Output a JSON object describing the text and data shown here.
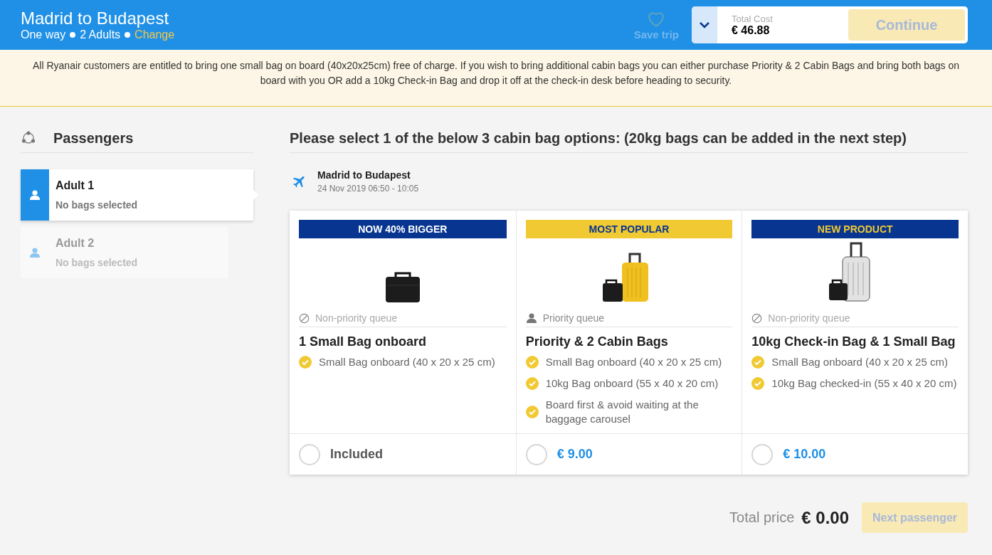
{
  "header": {
    "title": "Madrid to Budapest",
    "trip_type": "One way",
    "passengers": "2 Adults",
    "change_link": "Change",
    "save_trip": {
      "label": "Save trip",
      "disabled": true
    },
    "total_cost": {
      "label": "Total Cost",
      "amount": "€ 46.88"
    },
    "continue_button": {
      "label": "Continue",
      "disabled": true
    }
  },
  "notice": "All Ryanair customers are entitled to bring one small bag on board (40x20x25cm) free of charge. If you wish to bring additional cabin bags you can either purchase Priority & 2 Cabin Bags and bring both bags on board with you OR add a 10kg Check-in Bag and drop it off at the check-in desk before heading to security.",
  "sidebar": {
    "title": "Passengers",
    "passengers": [
      {
        "name": "Adult 1",
        "status": "No bags selected",
        "selected": true
      },
      {
        "name": "Adult 2",
        "status": "No bags selected",
        "selected": false
      }
    ]
  },
  "main": {
    "heading": "Please select 1 of the below 3 cabin bag options: (20kg bags can be added in the next step)",
    "flight": {
      "route": "Madrid to Budapest",
      "date_time": "24 Nov 2019  06:50 - 10:05"
    },
    "options": [
      {
        "badge": {
          "label": "NOW 40% BIGGER",
          "color": "#073590",
          "accent": false
        },
        "kind": "small-bag",
        "queue": {
          "priority": false,
          "label": "Non-priority queue"
        },
        "title": "1 Small Bag onboard",
        "features": [
          "Small Bag onboard (40 x 20 x 25 cm)"
        ],
        "price": "Included",
        "included": true,
        "selected": false
      },
      {
        "badge": {
          "label": "MOST POPULAR",
          "color": "#f1c933",
          "accent": false
        },
        "kind": "yellow-suitcase",
        "queue": {
          "priority": true,
          "label": "Priority queue"
        },
        "title": "Priority & 2 Cabin Bags",
        "features": [
          "Small Bag onboard (40 x 20 x 25 cm)",
          "10kg Bag onboard (55 x 40 x 20 cm)",
          "Board first & avoid waiting at the baggage carousel"
        ],
        "price": "€ 9.00",
        "included": false,
        "selected": false
      },
      {
        "badge": {
          "label": "NEW PRODUCT",
          "color": "#073590",
          "accent": true
        },
        "kind": "silver-suitcase",
        "queue": {
          "priority": false,
          "label": "Non-priority queue"
        },
        "title": "10kg Check-in Bag & 1 Small Bag",
        "features": [
          "Small Bag onboard (40 x 20 x 25 cm)",
          "10kg Bag checked-in (55 x 40 x 20 cm)"
        ],
        "price": "€ 10.00",
        "included": false,
        "selected": false
      }
    ]
  },
  "footer": {
    "total_label": "Total price",
    "total": "€ 0.00",
    "next_button": {
      "label": "Next passenger",
      "disabled": true
    }
  }
}
